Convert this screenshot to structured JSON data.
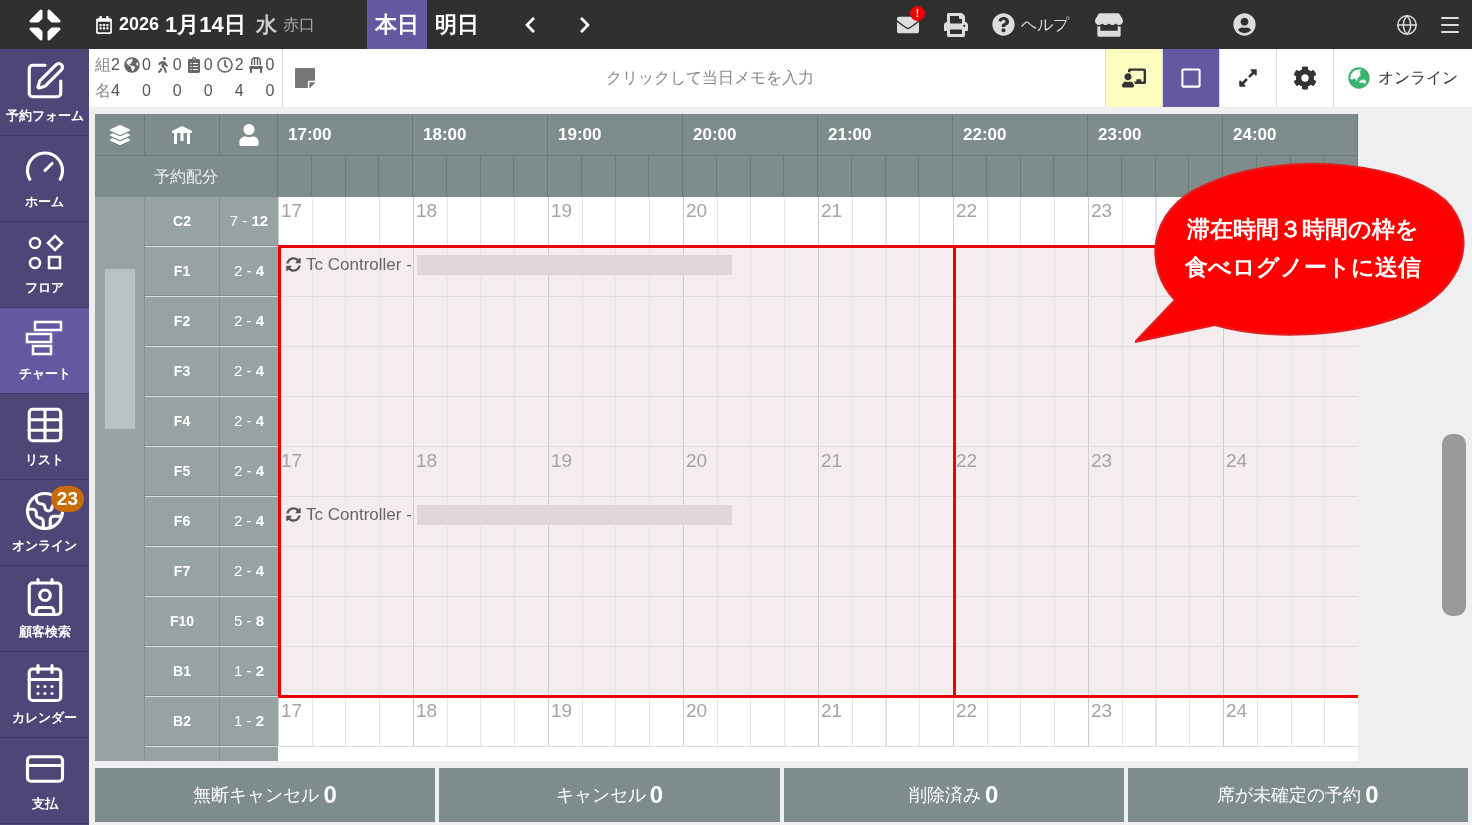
{
  "top_bar": {
    "year": "2026",
    "date": "1月14日",
    "weekday": "水",
    "rokuyo": "赤口",
    "day_tabs": [
      {
        "label": "本日",
        "selected": true
      },
      {
        "label": "明日",
        "selected": false
      }
    ],
    "mail_badge": "!",
    "help_label": "ヘルプ"
  },
  "sidebar": {
    "items": [
      {
        "kind": "form",
        "label": "予約フォーム",
        "selected": false
      },
      {
        "kind": "home",
        "label": "ホーム",
        "selected": false
      },
      {
        "kind": "floor",
        "label": "フロア",
        "selected": false
      },
      {
        "kind": "chart",
        "label": "チャート",
        "selected": true
      },
      {
        "kind": "list",
        "label": "リスト",
        "selected": false
      },
      {
        "kind": "online",
        "label": "オンライン",
        "selected": false,
        "badge": "23"
      },
      {
        "kind": "customer",
        "label": "顧客検索",
        "selected": false
      },
      {
        "kind": "calendar",
        "label": "カレンダー",
        "selected": false
      },
      {
        "kind": "payment",
        "label": "支払",
        "selected": false
      }
    ]
  },
  "summary": {
    "groups_label": "組",
    "people_label": "名",
    "groups": "2",
    "people": "4",
    "columns": [
      {
        "kind": "web",
        "groups": "0",
        "people": "0"
      },
      {
        "kind": "walk_in",
        "groups": "0",
        "people": "0"
      },
      {
        "kind": "memo",
        "groups": "0",
        "people": "0"
      },
      {
        "kind": "waiting",
        "groups": "2",
        "people": "4"
      },
      {
        "kind": "seated",
        "groups": "0",
        "people": "0"
      }
    ]
  },
  "memo": {
    "placeholder": "クリックして当日メモを入力"
  },
  "view_buttons": [
    {
      "kind": "presentation",
      "selected": true
    },
    {
      "kind": "frame",
      "selected": true
    },
    {
      "kind": "expand",
      "selected": false
    },
    {
      "kind": "settings",
      "selected": false
    }
  ],
  "status": {
    "label": "オンライン"
  },
  "chart": {
    "allocation_label": "予約配分",
    "hours": [
      "17:00",
      "18:00",
      "19:00",
      "20:00",
      "21:00",
      "22:00",
      "23:00",
      "24:00"
    ],
    "rows": [
      {
        "name": "C2",
        "capacity": "7 - **12**",
        "highlighted": false,
        "hour_labels": [
          "17",
          "18",
          "19",
          "20",
          "21",
          "22",
          "23"
        ]
      },
      {
        "name": "F1",
        "capacity": "2 - **4**",
        "highlighted": true,
        "reservation": "Tc Controller -"
      },
      {
        "name": "F2",
        "capacity": "2 - **4**",
        "highlighted": true
      },
      {
        "name": "F3",
        "capacity": "2 - **4**",
        "highlighted": true
      },
      {
        "name": "F4",
        "capacity": "2 - **4**",
        "highlighted": true
      },
      {
        "name": "F5",
        "capacity": "2 - **4**",
        "highlighted": true,
        "hour_labels": [
          "17",
          "18",
          "19",
          "20",
          "21",
          "22",
          "23",
          "24"
        ]
      },
      {
        "name": "F6",
        "capacity": "2 - **4**",
        "highlighted": true,
        "reservation": "Tc Controller -"
      },
      {
        "name": "F7",
        "capacity": "2 - **4**",
        "highlighted": true
      },
      {
        "name": "F10",
        "capacity": "5 - **8**",
        "highlighted": true
      },
      {
        "name": "B1",
        "capacity": "1 - **2**",
        "highlighted": true
      },
      {
        "name": "B2",
        "capacity": "1 - **2**",
        "highlighted": false,
        "hour_labels": [
          "17",
          "18",
          "19",
          "20",
          "21",
          "22",
          "23",
          "24"
        ]
      }
    ]
  },
  "callout": {
    "lines": [
      "滞在時間３時間の枠を",
      "食べログノートに送信"
    ]
  },
  "footer": [
    {
      "label": "無断キャンセル",
      "count": "0"
    },
    {
      "label": "キャンセル",
      "count": "0"
    },
    {
      "label": "削除済み",
      "count": "0"
    },
    {
      "label": "席が未確定の予約",
      "count": "0"
    }
  ]
}
